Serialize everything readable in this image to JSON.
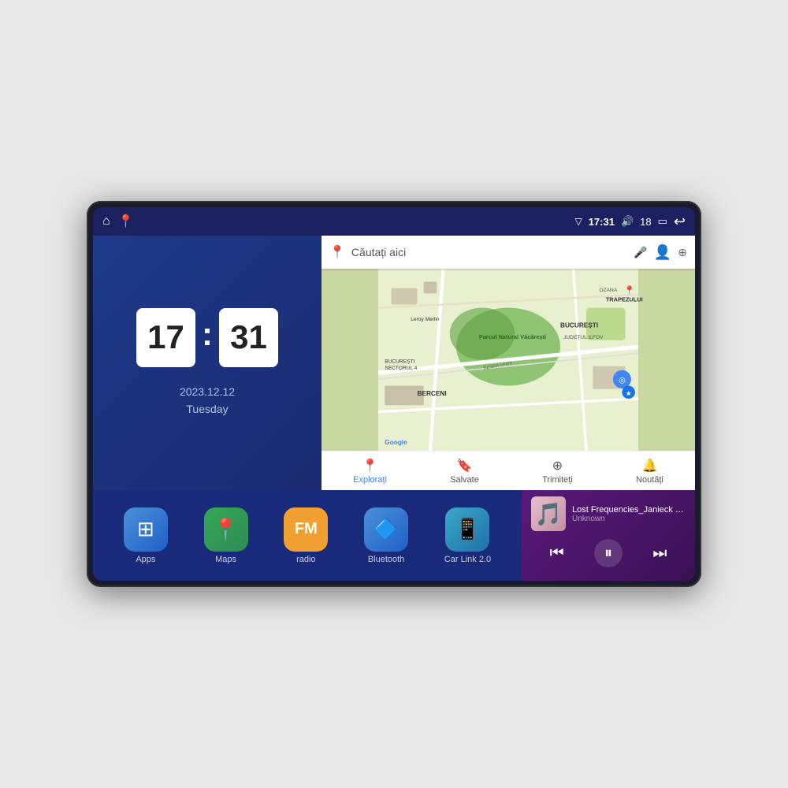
{
  "device": {
    "screen_bg": "#1a2060"
  },
  "status_bar": {
    "time": "17:31",
    "signal_icon": "▽",
    "volume_icon": "🔊",
    "battery_level": "18",
    "battery_icon": "🔋",
    "back_icon": "↩"
  },
  "clock": {
    "hour": "17",
    "minute": "31",
    "date": "2023.12.12",
    "day": "Tuesday"
  },
  "map": {
    "search_placeholder": "Căutați aici",
    "footer_items": [
      {
        "label": "Explorați",
        "active": true
      },
      {
        "label": "Salvate",
        "active": false
      },
      {
        "label": "Trimiteți",
        "active": false
      },
      {
        "label": "Noutăți",
        "active": false
      }
    ]
  },
  "apps": [
    {
      "label": "Apps",
      "icon": "⊞",
      "bg": "apps-bg"
    },
    {
      "label": "Maps",
      "icon": "📍",
      "bg": "maps-bg"
    },
    {
      "label": "radio",
      "icon": "📻",
      "bg": "radio-bg"
    },
    {
      "label": "Bluetooth",
      "icon": "🔷",
      "bg": "bt-bg"
    },
    {
      "label": "Car Link 2.0",
      "icon": "📱",
      "bg": "carlink-bg"
    }
  ],
  "music": {
    "title": "Lost Frequencies_Janieck Devy-...",
    "artist": "Unknown",
    "controls": {
      "prev": "⏮",
      "play": "⏸",
      "next": "⏭"
    }
  }
}
